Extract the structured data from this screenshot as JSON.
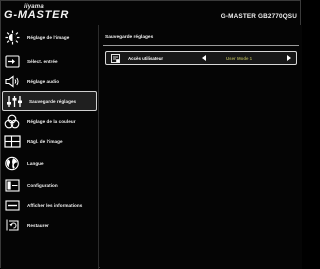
{
  "header": {
    "brand_top": "iiyama",
    "brand": "G-MASTER",
    "model": "G-MASTER GB2770QSU"
  },
  "sidebar": {
    "items": [
      {
        "label": "Réglage de l'image",
        "icon": "brightness-icon"
      },
      {
        "label": "Sélect. entrée",
        "icon": "input-icon"
      },
      {
        "label": "Réglage audio",
        "icon": "speaker-icon"
      },
      {
        "label": "Sauvegarde réglages",
        "icon": "sliders-icon",
        "active": true
      },
      {
        "label": "Réglage de la couleur",
        "icon": "color-circles-icon"
      },
      {
        "label": "Rägl. de l'image",
        "icon": "image-grid-icon"
      },
      {
        "label": "Langue",
        "icon": "globe-icon"
      },
      {
        "label": "Configuration",
        "icon": "setup-icon"
      },
      {
        "label": "Afficher les informations",
        "icon": "information-icon"
      },
      {
        "label": "Restaurer",
        "icon": "reset-icon"
      }
    ]
  },
  "main": {
    "section_title": "Sauvegarde réglages",
    "setting": {
      "label": "Accès utilisateur",
      "value": "User Mode 1",
      "icon": "user-mode-icon"
    }
  },
  "colors": {
    "background": "#050505",
    "active_border": "#cfcfcf",
    "value_text": "#9d9d4f"
  }
}
